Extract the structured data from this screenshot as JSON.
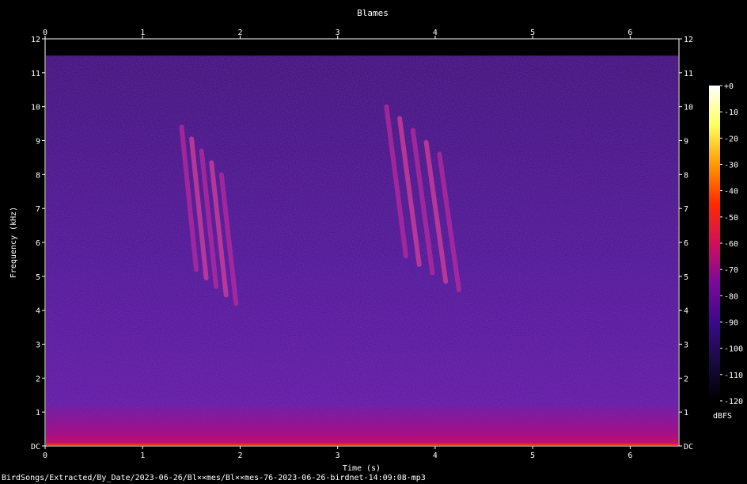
{
  "footer_path": "BirdSongs/Extracted/By_Date/2023-06-26/Bl××mes/Bl××mes-76-2023-06-26-birdnet-14:09:08·mp3",
  "chart_data": {
    "type": "heatmap",
    "title": "Blames",
    "xlabel": "Time (s)",
    "ylabel": "Frequency (kHz)",
    "xlim": [
      0,
      6.5
    ],
    "ylim": [
      0,
      12
    ],
    "x_ticks": [
      "0",
      "1",
      "2",
      "3",
      "4",
      "5",
      "6"
    ],
    "y_ticks": [
      "DC",
      "1",
      "2",
      "3",
      "4",
      "5",
      "6",
      "7",
      "8",
      "9",
      "10",
      "11",
      "12"
    ],
    "colorbar": {
      "label": "dBFS",
      "ticks": [
        "+0",
        "-10",
        "-20",
        "-30",
        "-40",
        "-50",
        "-60",
        "-70",
        "-80",
        "-90",
        "-100",
        "-110",
        "-120"
      ],
      "range": [
        -120,
        0
      ],
      "colors": [
        "#000000",
        "#1a0a40",
        "#3a0a8a",
        "#7a0a9a",
        "#d0105a",
        "#ff2a00",
        "#ff9a00",
        "#ffff60",
        "#ffffff"
      ]
    },
    "signal_max_khz": 11.5,
    "calls": [
      {
        "t_start": 1.4,
        "t_end": 2.0,
        "f_high": 9.4,
        "f_low": 4.2,
        "peak_dbfs": -55
      },
      {
        "t_start": 3.5,
        "t_end": 4.3,
        "f_high": 10.0,
        "f_low": 4.6,
        "peak_dbfs": -55
      }
    ]
  }
}
